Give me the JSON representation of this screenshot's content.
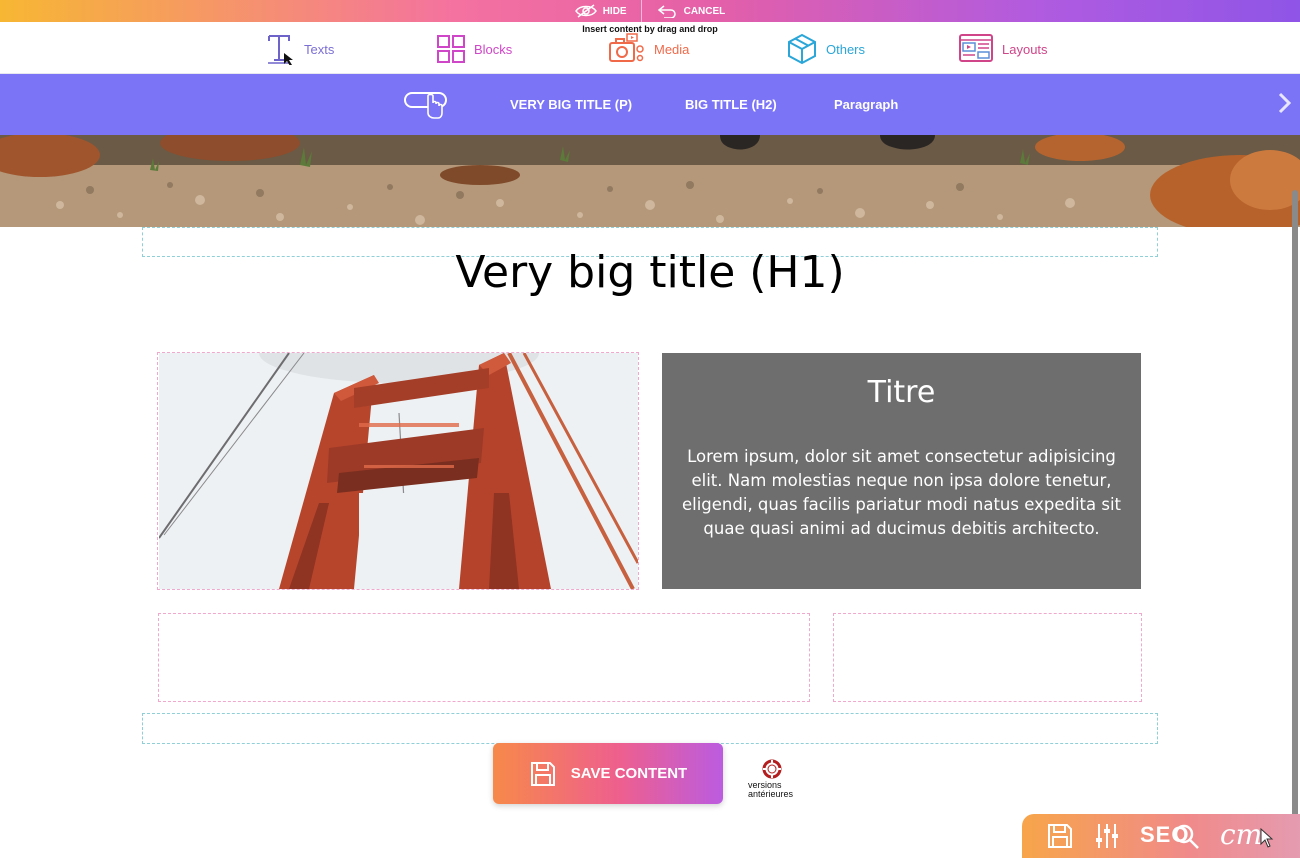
{
  "topbar": {
    "hide_label": "HIDE",
    "cancel_label": "CANCEL"
  },
  "insert": {
    "hint": "Insert content by drag and drop",
    "tabs": [
      {
        "label": "Texts",
        "icon": "text-icon",
        "color": "#7b6fd6"
      },
      {
        "label": "Blocks",
        "icon": "blocks-icon",
        "color": "#d046c8"
      },
      {
        "label": "Media",
        "icon": "camera-icon",
        "color": "#f06a4a"
      },
      {
        "label": "Others",
        "icon": "box-icon",
        "color": "#2aa6d8"
      },
      {
        "label": "Layouts",
        "icon": "layouts-icon",
        "color": "#d0458a"
      }
    ]
  },
  "subbar": {
    "items": [
      "VERY BIG TITLE (P)",
      "BIG TITLE (H2)",
      "Paragraph"
    ],
    "color": "#7b74f7"
  },
  "content": {
    "h1": "Very big title (H1)",
    "card": {
      "title": "Titre",
      "text": "Lorem ipsum, dolor sit amet consectetur adipisicing elit. Nam molestias neque non ipsa dolore tenetur, eligendi, quas facilis pariatur modi natus expedita sit quae quasi animi ad ducimus debitis architecto."
    }
  },
  "save": {
    "label": "SAVE CONTENT"
  },
  "versions": {
    "line1": "versions",
    "line2": "antérieures"
  },
  "cms_toolbar": {
    "seo_label": "SEO",
    "logo_text": "cm"
  }
}
